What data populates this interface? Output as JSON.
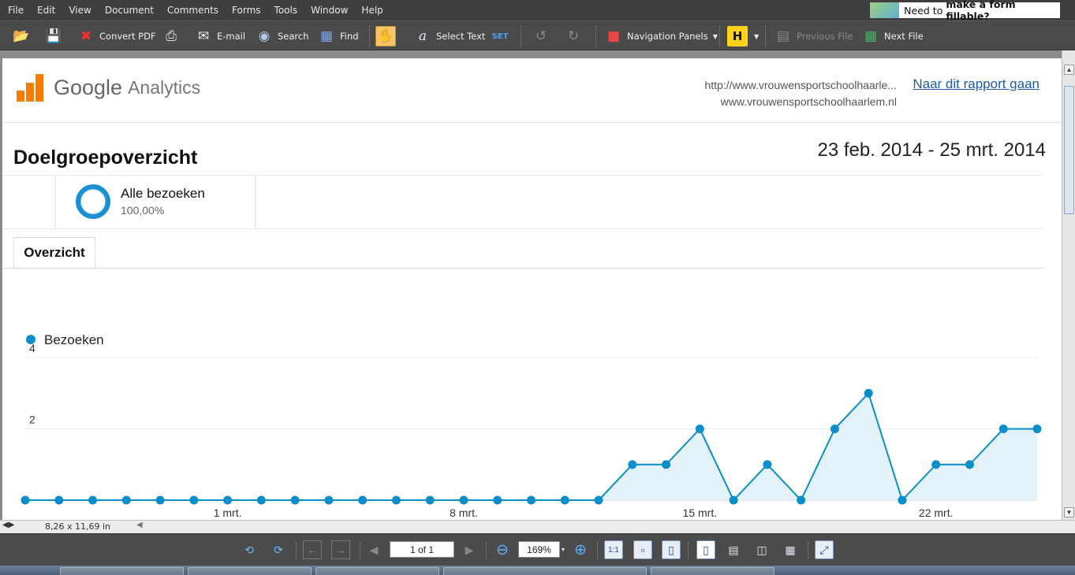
{
  "menu": [
    "File",
    "Edit",
    "View",
    "Document",
    "Comments",
    "Forms",
    "Tools",
    "Window",
    "Help"
  ],
  "ad": {
    "prefix": "Need to ",
    "bold": "make a form fillable?"
  },
  "toolbar": {
    "convert_pdf": "Convert PDF",
    "email": "E-mail",
    "search": "Search",
    "find": "Find",
    "select_text": "Select Text",
    "navigation_panels": "Navigation Panels",
    "previous_file": "Previous File",
    "next_file": "Next File"
  },
  "page": {
    "logo_google": "Google",
    "logo_analytics": "Analytics",
    "site_url_1": "http://www.vrouwensportschoolhaarle...",
    "site_url_2": "www.vrouwensportschoolhaarlem.nl",
    "report_link": "Naar dit rapport gaan",
    "title": "Doelgroepoverzicht",
    "date_range": "23 feb. 2014 - 25 mrt. 2014",
    "segment_name": "Alle bezoeken",
    "segment_pct": "100,00%",
    "tab_label": "Overzicht"
  },
  "chart_data": {
    "type": "area",
    "series": [
      {
        "name": "Bezoeken",
        "values": [
          0,
          0,
          0,
          0,
          0,
          0,
          0,
          0,
          0,
          0,
          0,
          0,
          0,
          0,
          0,
          0,
          0,
          0,
          1,
          1,
          2,
          0,
          1,
          0,
          2,
          3,
          0,
          1,
          1,
          2,
          2
        ]
      }
    ],
    "x_tick_labels": [
      "1 mrt.",
      "8 mrt.",
      "15 mrt.",
      "22 mrt."
    ],
    "x_tick_index": [
      6,
      13,
      20,
      27
    ],
    "y_ticks": [
      2,
      4
    ],
    "ylim": [
      0,
      4
    ],
    "grid": true,
    "legend": "top-left",
    "colors": {
      "line": "#0a8ec9",
      "fill": "#e3f1f9"
    }
  },
  "status": {
    "page_size": "8,26 x 11,69 in"
  },
  "nav": {
    "page_field": "1 of 1",
    "zoom": "169%"
  }
}
